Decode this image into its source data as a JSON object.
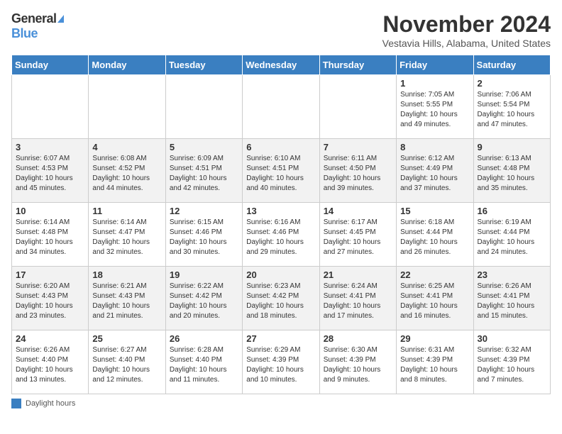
{
  "logo": {
    "general": "General",
    "blue": "Blue"
  },
  "title": "November 2024",
  "location": "Vestavia Hills, Alabama, United States",
  "days_of_week": [
    "Sunday",
    "Monday",
    "Tuesday",
    "Wednesday",
    "Thursday",
    "Friday",
    "Saturday"
  ],
  "legend": "Daylight hours",
  "weeks": [
    [
      {
        "date": "",
        "info": ""
      },
      {
        "date": "",
        "info": ""
      },
      {
        "date": "",
        "info": ""
      },
      {
        "date": "",
        "info": ""
      },
      {
        "date": "",
        "info": ""
      },
      {
        "date": "1",
        "info": "Sunrise: 7:05 AM\nSunset: 5:55 PM\nDaylight: 10 hours\nand 49 minutes."
      },
      {
        "date": "2",
        "info": "Sunrise: 7:06 AM\nSunset: 5:54 PM\nDaylight: 10 hours\nand 47 minutes."
      }
    ],
    [
      {
        "date": "3",
        "info": "Sunrise: 6:07 AM\nSunset: 4:53 PM\nDaylight: 10 hours\nand 45 minutes."
      },
      {
        "date": "4",
        "info": "Sunrise: 6:08 AM\nSunset: 4:52 PM\nDaylight: 10 hours\nand 44 minutes."
      },
      {
        "date": "5",
        "info": "Sunrise: 6:09 AM\nSunset: 4:51 PM\nDaylight: 10 hours\nand 42 minutes."
      },
      {
        "date": "6",
        "info": "Sunrise: 6:10 AM\nSunset: 4:51 PM\nDaylight: 10 hours\nand 40 minutes."
      },
      {
        "date": "7",
        "info": "Sunrise: 6:11 AM\nSunset: 4:50 PM\nDaylight: 10 hours\nand 39 minutes."
      },
      {
        "date": "8",
        "info": "Sunrise: 6:12 AM\nSunset: 4:49 PM\nDaylight: 10 hours\nand 37 minutes."
      },
      {
        "date": "9",
        "info": "Sunrise: 6:13 AM\nSunset: 4:48 PM\nDaylight: 10 hours\nand 35 minutes."
      }
    ],
    [
      {
        "date": "10",
        "info": "Sunrise: 6:14 AM\nSunset: 4:48 PM\nDaylight: 10 hours\nand 34 minutes."
      },
      {
        "date": "11",
        "info": "Sunrise: 6:14 AM\nSunset: 4:47 PM\nDaylight: 10 hours\nand 32 minutes."
      },
      {
        "date": "12",
        "info": "Sunrise: 6:15 AM\nSunset: 4:46 PM\nDaylight: 10 hours\nand 30 minutes."
      },
      {
        "date": "13",
        "info": "Sunrise: 6:16 AM\nSunset: 4:46 PM\nDaylight: 10 hours\nand 29 minutes."
      },
      {
        "date": "14",
        "info": "Sunrise: 6:17 AM\nSunset: 4:45 PM\nDaylight: 10 hours\nand 27 minutes."
      },
      {
        "date": "15",
        "info": "Sunrise: 6:18 AM\nSunset: 4:44 PM\nDaylight: 10 hours\nand 26 minutes."
      },
      {
        "date": "16",
        "info": "Sunrise: 6:19 AM\nSunset: 4:44 PM\nDaylight: 10 hours\nand 24 minutes."
      }
    ],
    [
      {
        "date": "17",
        "info": "Sunrise: 6:20 AM\nSunset: 4:43 PM\nDaylight: 10 hours\nand 23 minutes."
      },
      {
        "date": "18",
        "info": "Sunrise: 6:21 AM\nSunset: 4:43 PM\nDaylight: 10 hours\nand 21 minutes."
      },
      {
        "date": "19",
        "info": "Sunrise: 6:22 AM\nSunset: 4:42 PM\nDaylight: 10 hours\nand 20 minutes."
      },
      {
        "date": "20",
        "info": "Sunrise: 6:23 AM\nSunset: 4:42 PM\nDaylight: 10 hours\nand 18 minutes."
      },
      {
        "date": "21",
        "info": "Sunrise: 6:24 AM\nSunset: 4:41 PM\nDaylight: 10 hours\nand 17 minutes."
      },
      {
        "date": "22",
        "info": "Sunrise: 6:25 AM\nSunset: 4:41 PM\nDaylight: 10 hours\nand 16 minutes."
      },
      {
        "date": "23",
        "info": "Sunrise: 6:26 AM\nSunset: 4:41 PM\nDaylight: 10 hours\nand 15 minutes."
      }
    ],
    [
      {
        "date": "24",
        "info": "Sunrise: 6:26 AM\nSunset: 4:40 PM\nDaylight: 10 hours\nand 13 minutes."
      },
      {
        "date": "25",
        "info": "Sunrise: 6:27 AM\nSunset: 4:40 PM\nDaylight: 10 hours\nand 12 minutes."
      },
      {
        "date": "26",
        "info": "Sunrise: 6:28 AM\nSunset: 4:40 PM\nDaylight: 10 hours\nand 11 minutes."
      },
      {
        "date": "27",
        "info": "Sunrise: 6:29 AM\nSunset: 4:39 PM\nDaylight: 10 hours\nand 10 minutes."
      },
      {
        "date": "28",
        "info": "Sunrise: 6:30 AM\nSunset: 4:39 PM\nDaylight: 10 hours\nand 9 minutes."
      },
      {
        "date": "29",
        "info": "Sunrise: 6:31 AM\nSunset: 4:39 PM\nDaylight: 10 hours\nand 8 minutes."
      },
      {
        "date": "30",
        "info": "Sunrise: 6:32 AM\nSunset: 4:39 PM\nDaylight: 10 hours\nand 7 minutes."
      }
    ]
  ]
}
